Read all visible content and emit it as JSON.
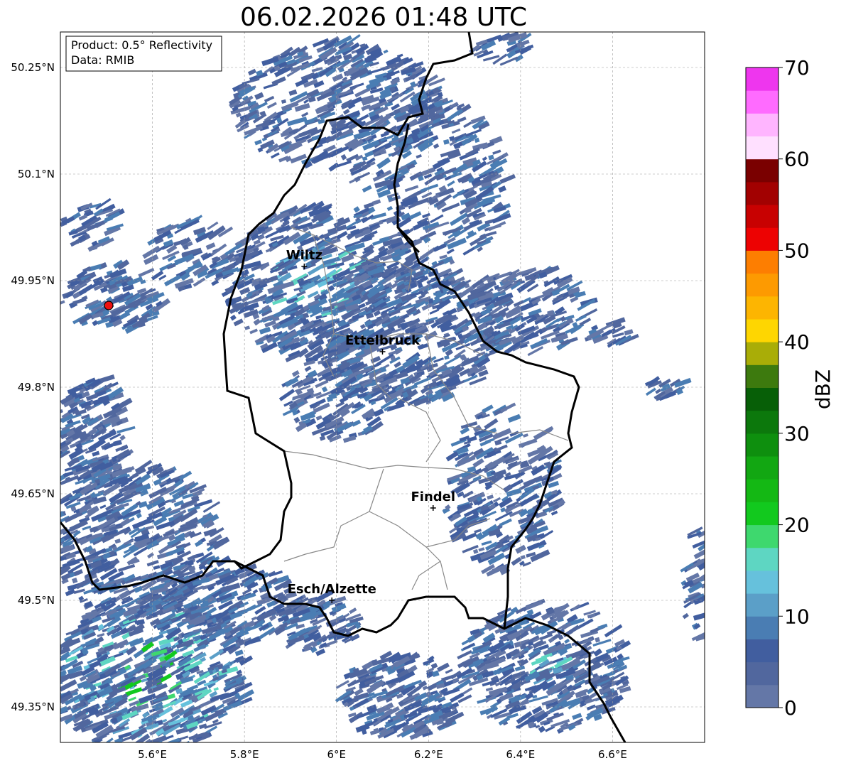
{
  "title": "06.02.2026 01:48 UTC",
  "info_box": {
    "product": "Product: 0.5° Reflectivity",
    "data_source": "Data: RMIB"
  },
  "lat_labels": [
    "50.25°N",
    "50.1°N",
    "49.95°N",
    "49.8°N",
    "49.65°N",
    "49.5°N",
    "49.35°N"
  ],
  "lon_labels": [
    "5.6°E",
    "5.8°E",
    "6°E",
    "6.2°E",
    "6.4°E",
    "6.6°E"
  ],
  "cities": [
    {
      "name": "Wiltz",
      "lat": 49.97,
      "lon": 5.93
    },
    {
      "name": "Ettelbruck",
      "lat": 49.85,
      "lon": 6.1
    },
    {
      "name": "Findel",
      "lat": 49.63,
      "lon": 6.21
    },
    {
      "name": "Esch/Alzette",
      "lat": 49.5,
      "lon": 5.99
    }
  ],
  "radar_site": {
    "lat": 49.915,
    "lon": 5.505
  },
  "colorbar": {
    "label": "dBZ",
    "ticks": [
      "0",
      "10",
      "20",
      "30",
      "40",
      "50",
      "60",
      "70"
    ],
    "colors": [
      "#6477a7",
      "#51679e",
      "#415e9f",
      "#4a7db3",
      "#5b9fc8",
      "#66c1dc",
      "#5ed6c2",
      "#3ed86e",
      "#12c91e",
      "#14b814",
      "#12a712",
      "#0e8f0e",
      "#0c780c",
      "#075f07",
      "#3d7a0e",
      "#a9ad07",
      "#fed601",
      "#fdb501",
      "#fd9a01",
      "#fd7e01",
      "#ed0202",
      "#c80101",
      "#a20101",
      "#7a0000",
      "#ffe0ff",
      "#ffb5ff",
      "#ff6bff",
      "#ee36ee"
    ]
  },
  "map_extent": {
    "lon_min": 5.4,
    "lon_max": 6.8,
    "lat_min": 49.3,
    "lat_max": 50.3
  }
}
